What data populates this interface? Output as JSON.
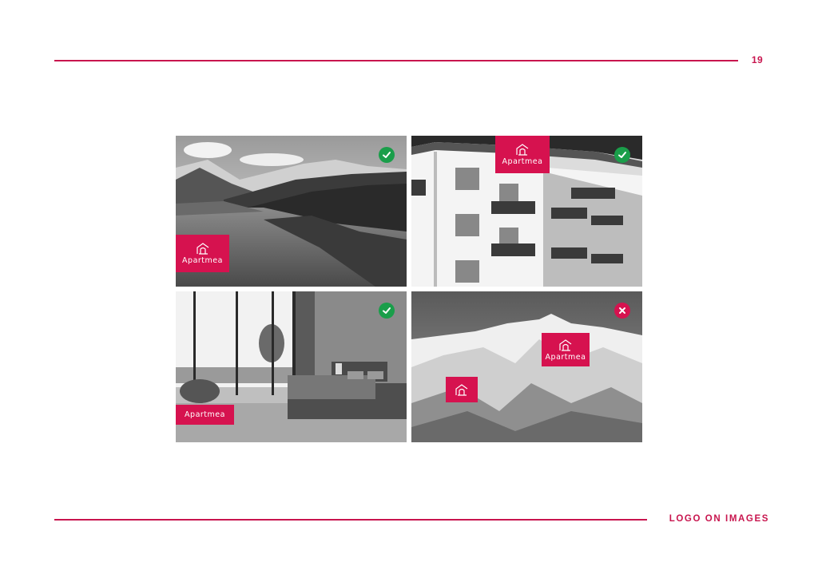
{
  "page": {
    "number": "19",
    "section_title": "LOGO ON IMAGES",
    "accent_color": "#c8154e"
  },
  "brand": {
    "wordmark": "Apartmea",
    "logo_color": "#d6124f"
  },
  "examples": [
    {
      "subject": "lake-mountain-landscape",
      "verdict": "correct",
      "badge_icon": "check-icon",
      "badge_color": "#1a9e4a"
    },
    {
      "subject": "apartment-building",
      "verdict": "correct",
      "badge_icon": "check-icon",
      "badge_color": "#1a9e4a"
    },
    {
      "subject": "bedroom-interior",
      "verdict": "correct",
      "badge_icon": "check-icon",
      "badge_color": "#1a9e4a"
    },
    {
      "subject": "snowy-mountains",
      "verdict": "incorrect",
      "badge_icon": "cross-icon",
      "badge_color": "#d6124f"
    }
  ]
}
